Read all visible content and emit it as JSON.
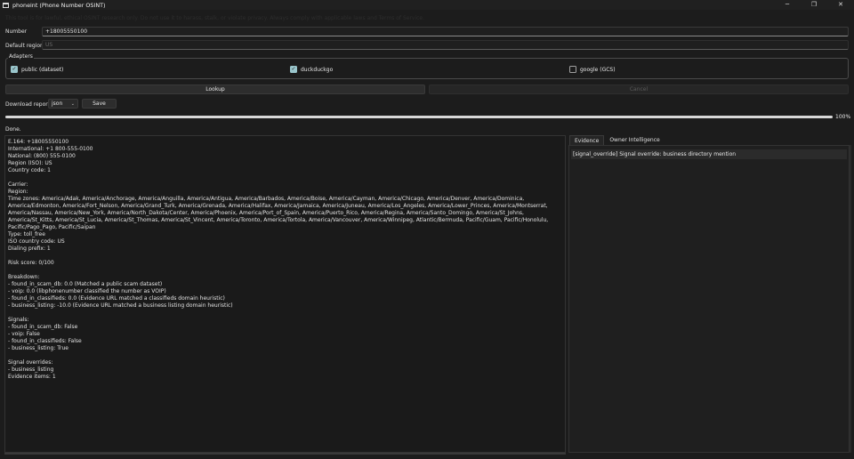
{
  "window": {
    "title": "phoneint (Phone Number OSINT)",
    "controls": {
      "minimize": "─",
      "maximize": "❐",
      "close": "✕"
    }
  },
  "disclaimer": "This tool is for lawful, ethical OSINT research only. Do not use it to harass, stalk, or violate privacy. Always comply with applicable laws and Terms of Service.",
  "form": {
    "number_label": "Number",
    "number_value": "+18005550100",
    "region_label": "Default region",
    "region_value": "US"
  },
  "adapters": {
    "title": "Adapters",
    "items": [
      {
        "label": "public (dataset)",
        "checked": true,
        "mark": "✓"
      },
      {
        "label": "duckduckgo",
        "checked": true,
        "mark": "✓"
      },
      {
        "label": "google (GCS)",
        "checked": false,
        "mark": ""
      }
    ]
  },
  "actions": {
    "lookup": "Lookup",
    "cancel": "Cancel"
  },
  "download": {
    "label": "Download report",
    "format": "json",
    "chevron": "⌄",
    "save": "Save"
  },
  "progress": {
    "value": 100,
    "text": "100%"
  },
  "status": "Done.",
  "report_lines": [
    "E.164: +18005550100",
    "International: +1 800-555-0100",
    "National: (800) 555-0100",
    "Region (ISO): US",
    "Country code: 1",
    "",
    "Carrier:",
    "Region:",
    "Time zones: America/Adak, America/Anchorage, America/Anguilla, America/Antigua, America/Barbados, America/Boise, America/Cayman, America/Chicago, America/Denver, America/Dominica, America/Edmonton, America/Fort_Nelson, America/Grand_Turk, America/Grenada, America/Halifax, America/Jamaica, America/Juneau, America/Los_Angeles, America/Lower_Princes, America/Montserrat, America/Nassau, America/New_York, America/North_Dakota/Center, America/Phoenix, America/Port_of_Spain, America/Puerto_Rico, America/Regina, America/Santo_Domingo, America/St_Johns, America/St_Kitts, America/St_Lucia, America/St_Thomas, America/St_Vincent, America/Toronto, America/Tortola, America/Vancouver, America/Winnipeg, Atlantic/Bermuda, Pacific/Guam, Pacific/Honolulu, Pacific/Pago_Pago, Pacific/Saipan",
    "Type: toll_free",
    "ISO country code: US",
    "Dialing prefix: 1",
    "",
    "Risk score: 0/100",
    "",
    "Breakdown:",
    "- found_in_scam_db: 0.0 (Matched a public scam dataset)",
    "- voip: 0.0 (libphonenumber classified the number as VOIP)",
    "- found_in_classifieds: 0.0 (Evidence URL matched a classifieds domain heuristic)",
    "- business_listing: -10.0 (Evidence URL matched a business listing domain heuristic)",
    "",
    "Signals:",
    "- found_in_scam_db: False",
    "- voip: False",
    "- found_in_classifieds: False",
    "- business_listing: True",
    "",
    "Signal overrides:",
    "- business_listing",
    "Evidence items: 1"
  ],
  "tabs": [
    {
      "label": "Evidence",
      "active": true
    },
    {
      "label": "Owner Intelligence",
      "active": false
    }
  ],
  "evidence_items": [
    "[signal_override] Signal override: business directory mention"
  ],
  "colors": {
    "background": "#1c1c1c",
    "checkbox_accent": "#9ac6cc",
    "progress_fill": "#d8d8d8"
  }
}
